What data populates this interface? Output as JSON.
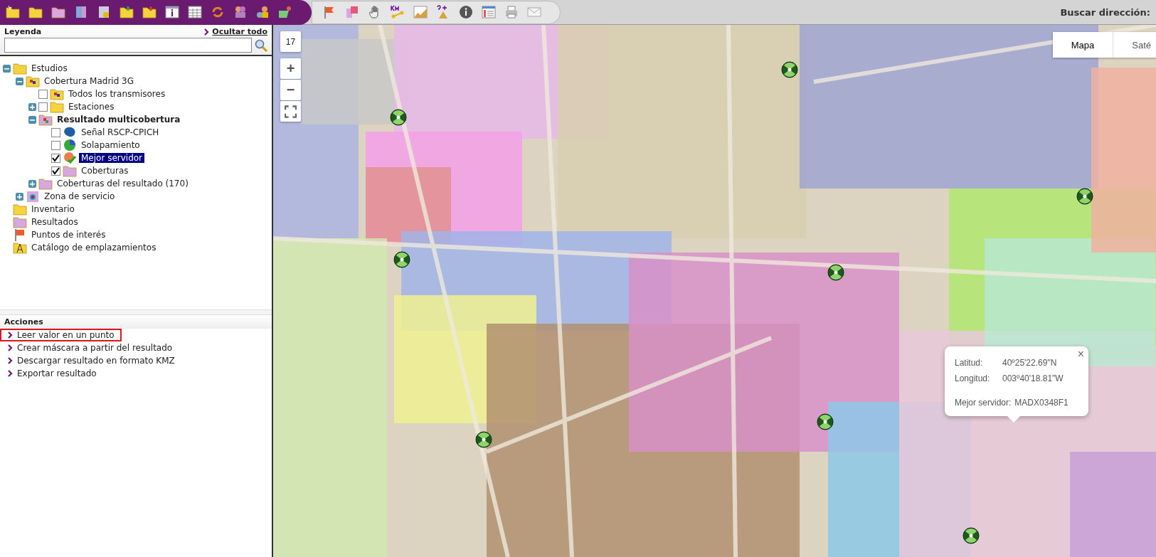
{
  "toolbar": {
    "search_label": "Buscar dirección:"
  },
  "legend": {
    "title": "Leyenda",
    "hide_all": "Ocultar todo",
    "tree": [
      {
        "label": "Estudios",
        "kind": "folder",
        "expanded": true,
        "current": false,
        "children": [
          {
            "label": "Cobertura Madrid 3G",
            "kind": "study",
            "expanded": true,
            "current": false,
            "children": [
              {
                "label": "Todos los transmisores",
                "kind": "study",
                "checked": false,
                "current": false,
                "selected": false
              },
              {
                "label": "Estaciones",
                "kind": "folder",
                "expanded": false,
                "checked": false,
                "current": false,
                "selected": false
              },
              {
                "label": "Resultado multicobertura",
                "kind": "result",
                "expanded": true,
                "current": true,
                "children": [
                  {
                    "label": "Señal RSCP-CPICH",
                    "kind": "signal",
                    "checked": false,
                    "current": false,
                    "selected": false
                  },
                  {
                    "label": "Solapamiento",
                    "kind": "overlap",
                    "checked": false,
                    "current": false,
                    "selected": false
                  },
                  {
                    "label": "Mejor servidor",
                    "kind": "server",
                    "checked": true,
                    "current": false,
                    "selected": true
                  },
                  {
                    "label": "Coberturas",
                    "kind": "pinkfolder",
                    "checked": true,
                    "current": false,
                    "selected": false
                  }
                ]
              },
              {
                "label": "Coberturas del resultado (170)",
                "kind": "pinkfolder",
                "expanded": false,
                "current": false
              }
            ]
          },
          {
            "label": "Zona de servicio",
            "kind": "zone",
            "expanded": false,
            "current": false
          }
        ]
      },
      {
        "label": "Inventario",
        "kind": "folder",
        "current": false
      },
      {
        "label": "Resultados",
        "kind": "pinkfolder",
        "current": false
      },
      {
        "label": "Puntos de interés",
        "kind": "flag",
        "current": false
      },
      {
        "label": "Catálogo de emplazamientos",
        "kind": "site",
        "current": false
      }
    ]
  },
  "actions": {
    "title": "Acciones",
    "items": [
      {
        "label": "Leer valor en un punto",
        "highlighted": true
      },
      {
        "label": "Crear máscara a partir del resultado",
        "highlighted": false
      },
      {
        "label": "Descargar resultado en formato KMZ",
        "highlighted": false
      },
      {
        "label": "Exportar resultado",
        "highlighted": false
      }
    ]
  },
  "map": {
    "zoom_level": "17",
    "zoom_in": "+",
    "zoom_out": "−",
    "map_types": [
      {
        "label": "Mapa",
        "selected": true
      },
      {
        "label": "Saté",
        "selected": false
      }
    ],
    "popup": {
      "close": "×",
      "rows": [
        {
          "label": "Latitud:",
          "value": "40º25'22.69\"N"
        },
        {
          "label": "Longitud:",
          "value": "003º40'18.81\"W"
        },
        {
          "label": "Mejor servidor:",
          "value": "MADX0348F1"
        }
      ]
    }
  }
}
